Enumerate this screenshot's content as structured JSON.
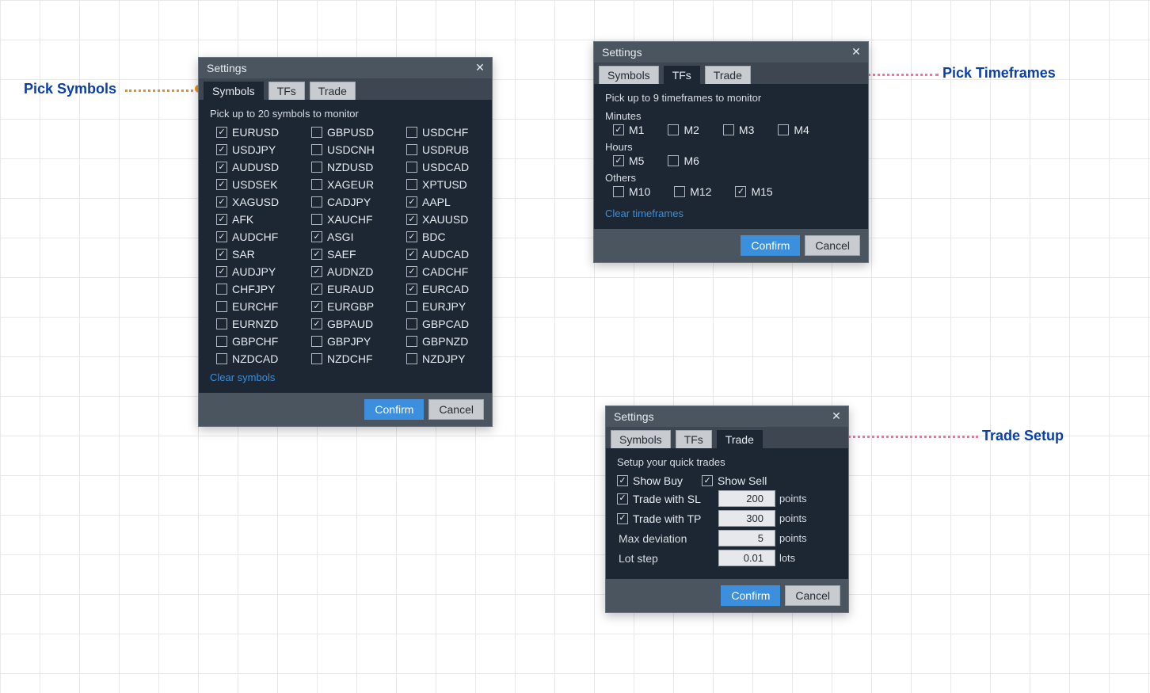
{
  "annotations": {
    "pick_symbols": "Pick Symbols",
    "pick_timeframes": "Pick Timeframes",
    "trade_setup": "Trade Setup"
  },
  "common": {
    "title": "Settings",
    "tabs": {
      "symbols": "Symbols",
      "tfs": "TFs",
      "trade": "Trade"
    },
    "confirm": "Confirm",
    "cancel": "Cancel"
  },
  "symbols_dialog": {
    "instruction": "Pick up to 20 symbols to monitor",
    "clear": "Clear symbols",
    "items": [
      {
        "label": "EURUSD",
        "checked": true
      },
      {
        "label": "GBPUSD",
        "checked": false
      },
      {
        "label": "USDCHF",
        "checked": false
      },
      {
        "label": "USDJPY",
        "checked": true
      },
      {
        "label": "USDCNH",
        "checked": false
      },
      {
        "label": "USDRUB",
        "checked": false
      },
      {
        "label": "AUDUSD",
        "checked": true
      },
      {
        "label": "NZDUSD",
        "checked": false
      },
      {
        "label": "USDCAD",
        "checked": false
      },
      {
        "label": "USDSEK",
        "checked": true
      },
      {
        "label": "XAGEUR",
        "checked": false
      },
      {
        "label": "XPTUSD",
        "checked": false
      },
      {
        "label": "XAGUSD",
        "checked": true
      },
      {
        "label": "CADJPY",
        "checked": false
      },
      {
        "label": "AAPL",
        "checked": true
      },
      {
        "label": "AFK",
        "checked": true
      },
      {
        "label": "XAUCHF",
        "checked": false
      },
      {
        "label": "XAUUSD",
        "checked": true
      },
      {
        "label": "AUDCHF",
        "checked": true
      },
      {
        "label": "ASGI",
        "checked": true
      },
      {
        "label": "BDC",
        "checked": true
      },
      {
        "label": "SAR",
        "checked": true
      },
      {
        "label": "SAEF",
        "checked": true
      },
      {
        "label": "AUDCAD",
        "checked": true
      },
      {
        "label": "AUDJPY",
        "checked": true
      },
      {
        "label": "AUDNZD",
        "checked": true
      },
      {
        "label": "CADCHF",
        "checked": true
      },
      {
        "label": "CHFJPY",
        "checked": false
      },
      {
        "label": "EURAUD",
        "checked": true
      },
      {
        "label": "EURCAD",
        "checked": true
      },
      {
        "label": "EURCHF",
        "checked": false
      },
      {
        "label": "EURGBP",
        "checked": true
      },
      {
        "label": "EURJPY",
        "checked": false
      },
      {
        "label": "EURNZD",
        "checked": false
      },
      {
        "label": "GBPAUD",
        "checked": true
      },
      {
        "label": "GBPCAD",
        "checked": false
      },
      {
        "label": "GBPCHF",
        "checked": false
      },
      {
        "label": "GBPJPY",
        "checked": false
      },
      {
        "label": "GBPNZD",
        "checked": false
      },
      {
        "label": "NZDCAD",
        "checked": false
      },
      {
        "label": "NZDCHF",
        "checked": false
      },
      {
        "label": "NZDJPY",
        "checked": false
      }
    ]
  },
  "tf_dialog": {
    "instruction": "Pick up to 9 timeframes to monitor",
    "sections": {
      "minutes": {
        "label": "Minutes",
        "items": [
          {
            "label": "M1",
            "checked": true
          },
          {
            "label": "M2",
            "checked": false
          },
          {
            "label": "M3",
            "checked": false
          },
          {
            "label": "M4",
            "checked": false
          }
        ]
      },
      "hours": {
        "label": "Hours",
        "items": [
          {
            "label": "M5",
            "checked": true
          },
          {
            "label": "M6",
            "checked": false
          }
        ]
      },
      "others": {
        "label": "Others",
        "items": [
          {
            "label": "M10",
            "checked": false
          },
          {
            "label": "M12",
            "checked": false
          },
          {
            "label": "M15",
            "checked": true
          }
        ]
      }
    },
    "clear": "Clear timeframes"
  },
  "trade_dialog": {
    "instruction": "Setup your quick trades",
    "show_buy": {
      "label": "Show Buy",
      "checked": true
    },
    "show_sell": {
      "label": "Show Sell",
      "checked": true
    },
    "trade_sl": {
      "label": "Trade with SL",
      "checked": true,
      "value": "200",
      "unit": "points"
    },
    "trade_tp": {
      "label": "Trade with TP",
      "checked": true,
      "value": "300",
      "unit": "points"
    },
    "max_dev": {
      "label": "Max deviation",
      "value": "5",
      "unit": "points"
    },
    "lot_step": {
      "label": "Lot step",
      "value": "0.01",
      "unit": "lots"
    }
  }
}
